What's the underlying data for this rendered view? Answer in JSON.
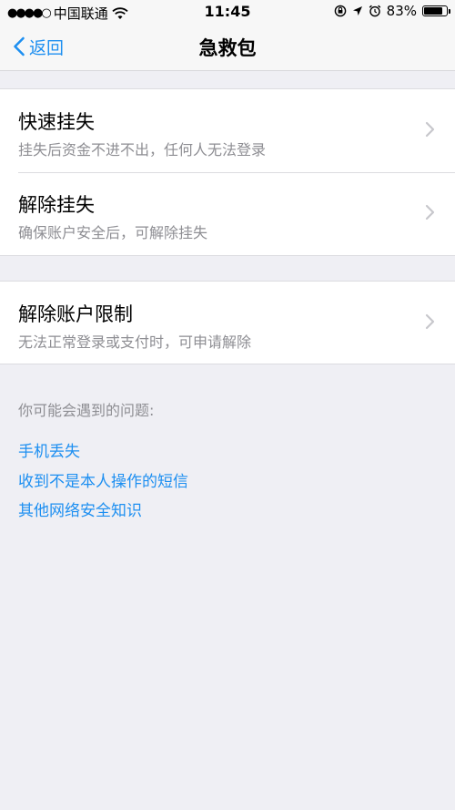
{
  "status_bar": {
    "signal": "●●●●○",
    "carrier": "中国联通",
    "time": "11:45",
    "battery": "83%",
    "battery_level": 0.83
  },
  "nav": {
    "back_label": "返回",
    "title": "急救包"
  },
  "menu": [
    {
      "title": "快速挂失",
      "subtitle": "挂失后资金不进不出，任何人无法登录"
    },
    {
      "title": "解除挂失",
      "subtitle": "确保账户安全后，可解除挂失"
    },
    {
      "title": "解除账户限制",
      "subtitle": "无法正常登录或支付时，可申请解除"
    }
  ],
  "faq": {
    "heading": "你可能会遇到的问题:",
    "links": [
      "手机丢失",
      "收到不是本人操作的短信",
      "其他网络安全知识"
    ]
  },
  "colors": {
    "accent": "#1d8ff1",
    "background": "#efeff4"
  }
}
